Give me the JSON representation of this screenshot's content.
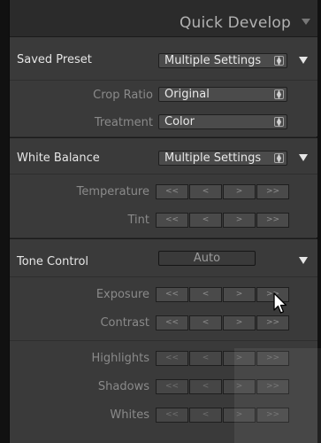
{
  "header": {
    "title": "Quick Develop"
  },
  "saved_preset": {
    "label": "Saved Preset",
    "value": "Multiple Settings",
    "crop_ratio": {
      "label": "Crop Ratio",
      "value": "Original"
    },
    "treatment": {
      "label": "Treatment",
      "value": "Color"
    }
  },
  "white_balance": {
    "label": "White Balance",
    "value": "Multiple Settings",
    "temperature": {
      "label": "Temperature",
      "buttons": [
        "<<",
        "<",
        ">",
        ">>"
      ]
    },
    "tint": {
      "label": "Tint",
      "buttons": [
        "<<",
        "<",
        ">",
        ">>"
      ]
    }
  },
  "tone_control": {
    "label": "Tone Control",
    "auto_label": "Auto",
    "exposure": {
      "label": "Exposure",
      "buttons": [
        "<<",
        "<",
        ">",
        ">>"
      ]
    },
    "contrast": {
      "label": "Contrast",
      "buttons": [
        "<<",
        "<",
        ">",
        ">>"
      ]
    },
    "highlights": {
      "label": "Highlights",
      "buttons": [
        "<<",
        "<",
        ">",
        ">>"
      ]
    },
    "shadows": {
      "label": "Shadows",
      "buttons": [
        "<<",
        "<",
        ">",
        ">>"
      ]
    },
    "whites": {
      "label": "Whites",
      "buttons": [
        "<<",
        "<",
        ">",
        ">>"
      ]
    }
  },
  "colors": {
    "panel": "#3a3a3a",
    "button": "#4a4a4a",
    "label": "#8a8a8a",
    "text": "#e6e6e6"
  }
}
